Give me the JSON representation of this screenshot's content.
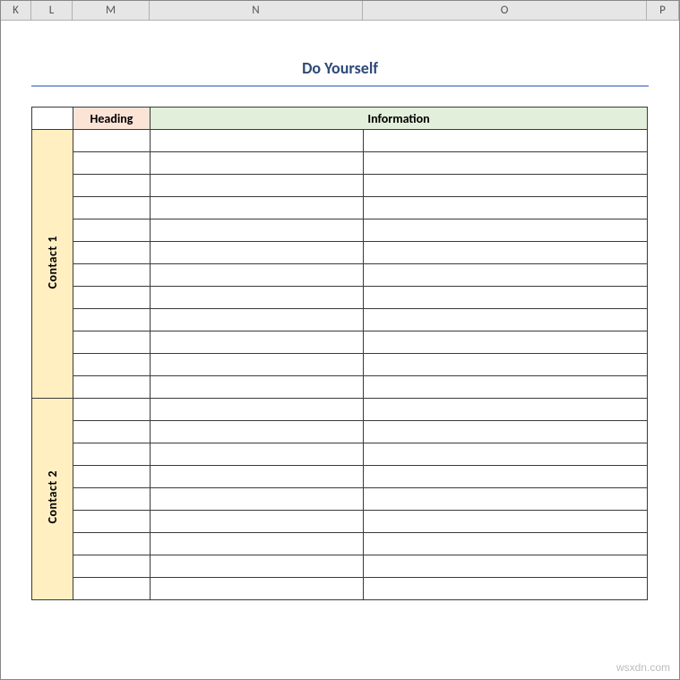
{
  "columns": {
    "K": "K",
    "L": "L",
    "M": "M",
    "N": "N",
    "O": "O",
    "P": "P"
  },
  "title": "Do Yourself",
  "headers": {
    "heading": "Heading",
    "information": "Information"
  },
  "sections": [
    {
      "label": "Contact 1",
      "rows": 12
    },
    {
      "label": "Contact 2",
      "rows": 9
    }
  ],
  "watermark": "wsxdn.com"
}
